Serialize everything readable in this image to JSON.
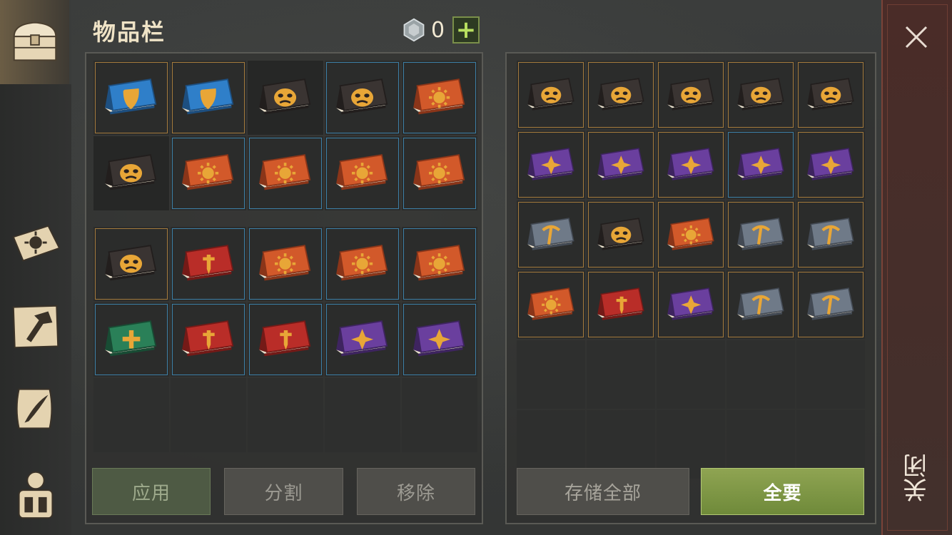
{
  "header": {
    "title": "物品栏"
  },
  "currency": {
    "value": "0",
    "icon": "gem-icon"
  },
  "sidebar": {
    "tabs": [
      {
        "icon": "chest-icon",
        "active": true
      },
      {
        "icon": "sun-book-icon",
        "active": false
      },
      {
        "icon": "hammer-map-icon",
        "active": false
      },
      {
        "icon": "scroll-quill-icon",
        "active": false
      },
      {
        "icon": "backpack-character-icon",
        "active": false
      }
    ]
  },
  "inventory": {
    "section1": [
      {
        "book": "blue-shield",
        "frame": "gold"
      },
      {
        "book": "blue-shield",
        "frame": "gold"
      },
      {
        "book": "black-mask",
        "frame": "none"
      },
      {
        "book": "black-mask",
        "frame": "blue"
      },
      {
        "book": "orange-sun",
        "frame": "blue"
      },
      {
        "book": "black-mask",
        "frame": "none"
      },
      {
        "book": "orange-sun",
        "frame": "blue"
      },
      {
        "book": "orange-sun",
        "frame": "blue"
      },
      {
        "book": "orange-sun",
        "frame": "blue"
      },
      {
        "book": "orange-sun",
        "frame": "blue"
      }
    ],
    "section2": [
      {
        "book": "black-mask",
        "frame": "gold"
      },
      {
        "book": "red-sword",
        "frame": "blue"
      },
      {
        "book": "orange-sun",
        "frame": "blue"
      },
      {
        "book": "orange-sun",
        "frame": "blue"
      },
      {
        "book": "orange-sun",
        "frame": "blue"
      },
      {
        "book": "green-cross",
        "frame": "blue"
      },
      {
        "book": "red-sword",
        "frame": "blue"
      },
      {
        "book": "red-sword",
        "frame": "blue"
      },
      {
        "book": "purple-star",
        "frame": "blue"
      },
      {
        "book": "purple-star",
        "frame": "blue"
      },
      {
        "book": "empty",
        "frame": "none"
      },
      {
        "book": "empty",
        "frame": "none"
      },
      {
        "book": "empty",
        "frame": "none"
      },
      {
        "book": "empty",
        "frame": "none"
      },
      {
        "book": "empty",
        "frame": "none"
      }
    ]
  },
  "container": {
    "slots": [
      {
        "book": "black-mask",
        "frame": "gold"
      },
      {
        "book": "black-mask",
        "frame": "gold"
      },
      {
        "book": "black-mask",
        "frame": "gold"
      },
      {
        "book": "black-mask",
        "frame": "gold"
      },
      {
        "book": "black-mask",
        "frame": "gold"
      },
      {
        "book": "purple-star",
        "frame": "gold"
      },
      {
        "book": "purple-star",
        "frame": "gold"
      },
      {
        "book": "purple-star",
        "frame": "gold"
      },
      {
        "book": "purple-star",
        "frame": "blue"
      },
      {
        "book": "purple-star",
        "frame": "gold"
      },
      {
        "book": "grey-pickaxe",
        "frame": "gold"
      },
      {
        "book": "black-mask",
        "frame": "gold"
      },
      {
        "book": "orange-sun",
        "frame": "gold"
      },
      {
        "book": "grey-pickaxe",
        "frame": "gold"
      },
      {
        "book": "grey-pickaxe",
        "frame": "gold"
      },
      {
        "book": "orange-sun",
        "frame": "gold"
      },
      {
        "book": "red-sword",
        "frame": "gold"
      },
      {
        "book": "purple-star",
        "frame": "gold"
      },
      {
        "book": "grey-pickaxe",
        "frame": "gold"
      },
      {
        "book": "grey-pickaxe",
        "frame": "gold"
      },
      {
        "book": "empty",
        "frame": "none"
      },
      {
        "book": "empty",
        "frame": "none"
      },
      {
        "book": "empty",
        "frame": "none"
      },
      {
        "book": "empty",
        "frame": "none"
      },
      {
        "book": "empty",
        "frame": "none"
      },
      {
        "book": "empty",
        "frame": "none"
      },
      {
        "book": "empty",
        "frame": "none"
      },
      {
        "book": "empty",
        "frame": "none"
      },
      {
        "book": "empty",
        "frame": "none"
      },
      {
        "book": "empty",
        "frame": "none"
      }
    ]
  },
  "buttons": {
    "apply": "应用",
    "split": "分割",
    "remove": "移除",
    "store_all": "存储全部",
    "take_all": "全要"
  },
  "close": {
    "label": "关闭"
  },
  "colors": {
    "gold_frame": "#a47a3c",
    "blue_frame": "#3c7fa6",
    "take_all_green": "#8fa452",
    "close_bar": "#4a2c28"
  }
}
